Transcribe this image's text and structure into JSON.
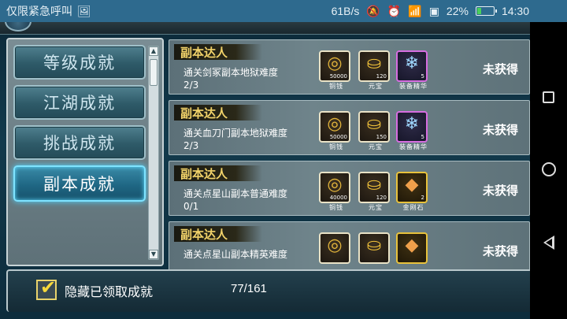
{
  "status_bar": {
    "notification_text": "仅限紧急呼叫",
    "notif_icon": "image-icon",
    "net_speed": "61B/s",
    "icons": [
      "mute-icon",
      "alarm-icon",
      "wifi-icon",
      "sim-icon"
    ],
    "battery_percent": "22%",
    "battery_level": 0.22,
    "time": "14:30"
  },
  "categories": [
    {
      "label": "等级成就",
      "active": false
    },
    {
      "label": "江湖成就",
      "active": false
    },
    {
      "label": "挑战成就",
      "active": false
    },
    {
      "label": "副本成就",
      "active": true
    }
  ],
  "achievements": [
    {
      "title": "副本达人",
      "desc": "通关剑冢副本地狱难度",
      "progress": "2/3",
      "status": "未获得",
      "rewards": [
        {
          "name": "铜钱",
          "qty": "50000",
          "icon": "coin-icon"
        },
        {
          "name": "元宝",
          "qty": "120",
          "icon": "ingot-icon"
        },
        {
          "name": "装备精华",
          "qty": "5",
          "icon": "crystal-icon"
        }
      ]
    },
    {
      "title": "副本达人",
      "desc": "通关血刀门副本地狱难度",
      "progress": "2/3",
      "status": "未获得",
      "rewards": [
        {
          "name": "铜钱",
          "qty": "50000",
          "icon": "coin-icon"
        },
        {
          "name": "元宝",
          "qty": "150",
          "icon": "ingot-icon"
        },
        {
          "name": "装备精华",
          "qty": "5",
          "icon": "crystal-icon"
        }
      ]
    },
    {
      "title": "副本达人",
      "desc": "通关点星山副本普通难度",
      "progress": "0/1",
      "status": "未获得",
      "rewards": [
        {
          "name": "铜钱",
          "qty": "40000",
          "icon": "coin-icon"
        },
        {
          "name": "元宝",
          "qty": "120",
          "icon": "ingot-icon"
        },
        {
          "name": "金刚石",
          "qty": "2",
          "icon": "diamond-icon"
        }
      ]
    },
    {
      "title": "副本达人",
      "desc": "通关点星山副本精英难度",
      "progress": "",
      "status": "未获得",
      "rewards": [
        {
          "name": "",
          "qty": "",
          "icon": "coin-icon"
        },
        {
          "name": "",
          "qty": "",
          "icon": "ingot-icon"
        },
        {
          "name": "",
          "qty": "",
          "icon": "diamond-icon"
        }
      ]
    }
  ],
  "bottom": {
    "hide_label": "隐藏已领取成就",
    "hide_checked": true,
    "count": "77/161"
  }
}
